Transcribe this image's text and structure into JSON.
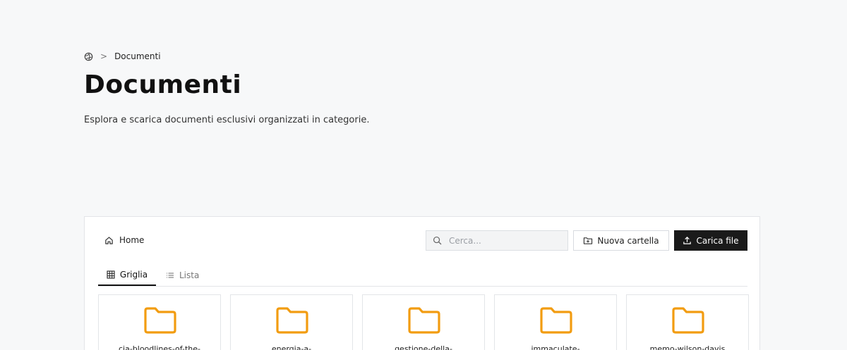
{
  "breadcrumb": {
    "home_icon": "globe-icon",
    "separator": ">",
    "current": "Documenti"
  },
  "header": {
    "title": "Documenti",
    "subtitle": "Esplora e scarica documenti esclusivi organizzati in categorie."
  },
  "explorer": {
    "path_root": "Home",
    "search": {
      "placeholder": "Cerca..."
    },
    "new_folder_label": "Nuova cartella",
    "upload_label": "Carica file",
    "tabs": [
      {
        "label": "Griglia",
        "active": true
      },
      {
        "label": "Lista",
        "active": false
      }
    ],
    "folders": [
      {
        "name": "cia-bloodlines-of-the-"
      },
      {
        "name": "energia-a-"
      },
      {
        "name": "gestione-della-"
      },
      {
        "name": "immaculate-"
      },
      {
        "name": "memo-wilson-davis"
      }
    ]
  },
  "colors": {
    "background": "#f7f8f9",
    "accent_dark": "#1a1a1a",
    "folder": "#f29c11"
  }
}
